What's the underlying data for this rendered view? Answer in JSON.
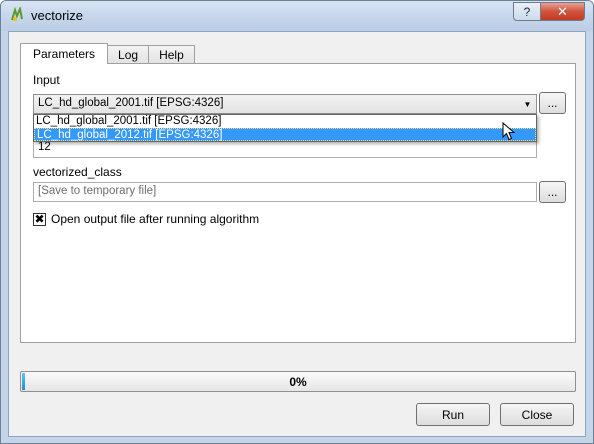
{
  "window": {
    "title": "vectorize",
    "help_label": "?",
    "close_label": "✕"
  },
  "tabs": [
    {
      "label": "Parameters",
      "active": true
    },
    {
      "label": "Log",
      "active": false
    },
    {
      "label": "Help",
      "active": false
    }
  ],
  "input": {
    "label": "Input",
    "value": "LC_hd_global_2001.tif [EPSG:4326]",
    "browse_label": "...",
    "options": [
      "LC_hd_global_2001.tif [EPSG:4326]",
      "LC_hd_global_2012.tif [EPSG:4326]"
    ],
    "highlighted_index": 1
  },
  "band_field": {
    "value": "12"
  },
  "vectorized_class": {
    "label": "vectorized_class",
    "placeholder": "[Save to temporary file]",
    "browse_label": "..."
  },
  "open_output": {
    "label": "Open output file after running algorithm",
    "checked": true,
    "check_glyph": "✖"
  },
  "progress": {
    "text": "0%",
    "value_percent": 0
  },
  "buttons": {
    "run": "Run",
    "close": "Close"
  }
}
